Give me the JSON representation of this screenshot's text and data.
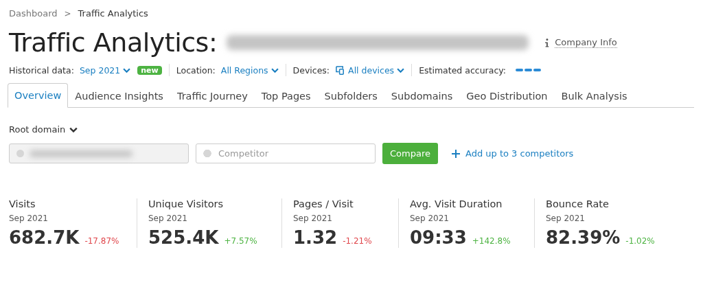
{
  "breadcrumbs": [
    "Dashboard",
    "Traffic Analytics"
  ],
  "separator": ">",
  "title": "Traffic Analytics:",
  "company_info": "Company Info",
  "filters": [
    {
      "label": "Historical data:",
      "value": "Sep 2021",
      "badge": "new"
    },
    {
      "label": "Location:",
      "value": "All Regions"
    },
    {
      "label": "Devices:",
      "value": "All devices"
    }
  ],
  "accuracy": {
    "label": "Estimated accuracy:"
  },
  "tabs": [
    {
      "label": "Overview",
      "selected": true
    },
    {
      "label": "Audience Insights",
      "selected": false
    },
    {
      "label": "Traffic Journey",
      "selected": false
    },
    {
      "label": "Top Pages",
      "selected": false
    },
    {
      "label": "Subfolders",
      "selected": false
    },
    {
      "label": "Subdomains",
      "selected": false
    },
    {
      "label": "Geo Distribution",
      "selected": false
    },
    {
      "label": "Bulk Analysis",
      "selected": false
    }
  ],
  "scope": "Root domain",
  "domain_field": {
    "disabled": true
  },
  "competitor_field": {
    "placeholder": "Competitor"
  },
  "compare_button": "Compare",
  "add_competitors": "Add up to 3 competitors",
  "metrics": [
    {
      "name": "Visits",
      "period": "Sep 2021",
      "value": "682.7K",
      "change": "-17.87%",
      "good": false
    },
    {
      "name": "Unique Visitors",
      "period": "Sep 2021",
      "value": "525.4K",
      "change": "+7.57%",
      "good": true
    },
    {
      "name": "Pages / Visit",
      "period": "Sep 2021",
      "value": "1.32",
      "change": "-1.21%",
      "good": false
    },
    {
      "name": "Avg. Visit Duration",
      "period": "Sep 2021",
      "value": "09:33",
      "change": "+142.8%",
      "good": true
    },
    {
      "name": "Bounce Rate",
      "period": "Sep 2021",
      "value": "82.39%",
      "change": "-1.02%",
      "good": true
    }
  ]
}
